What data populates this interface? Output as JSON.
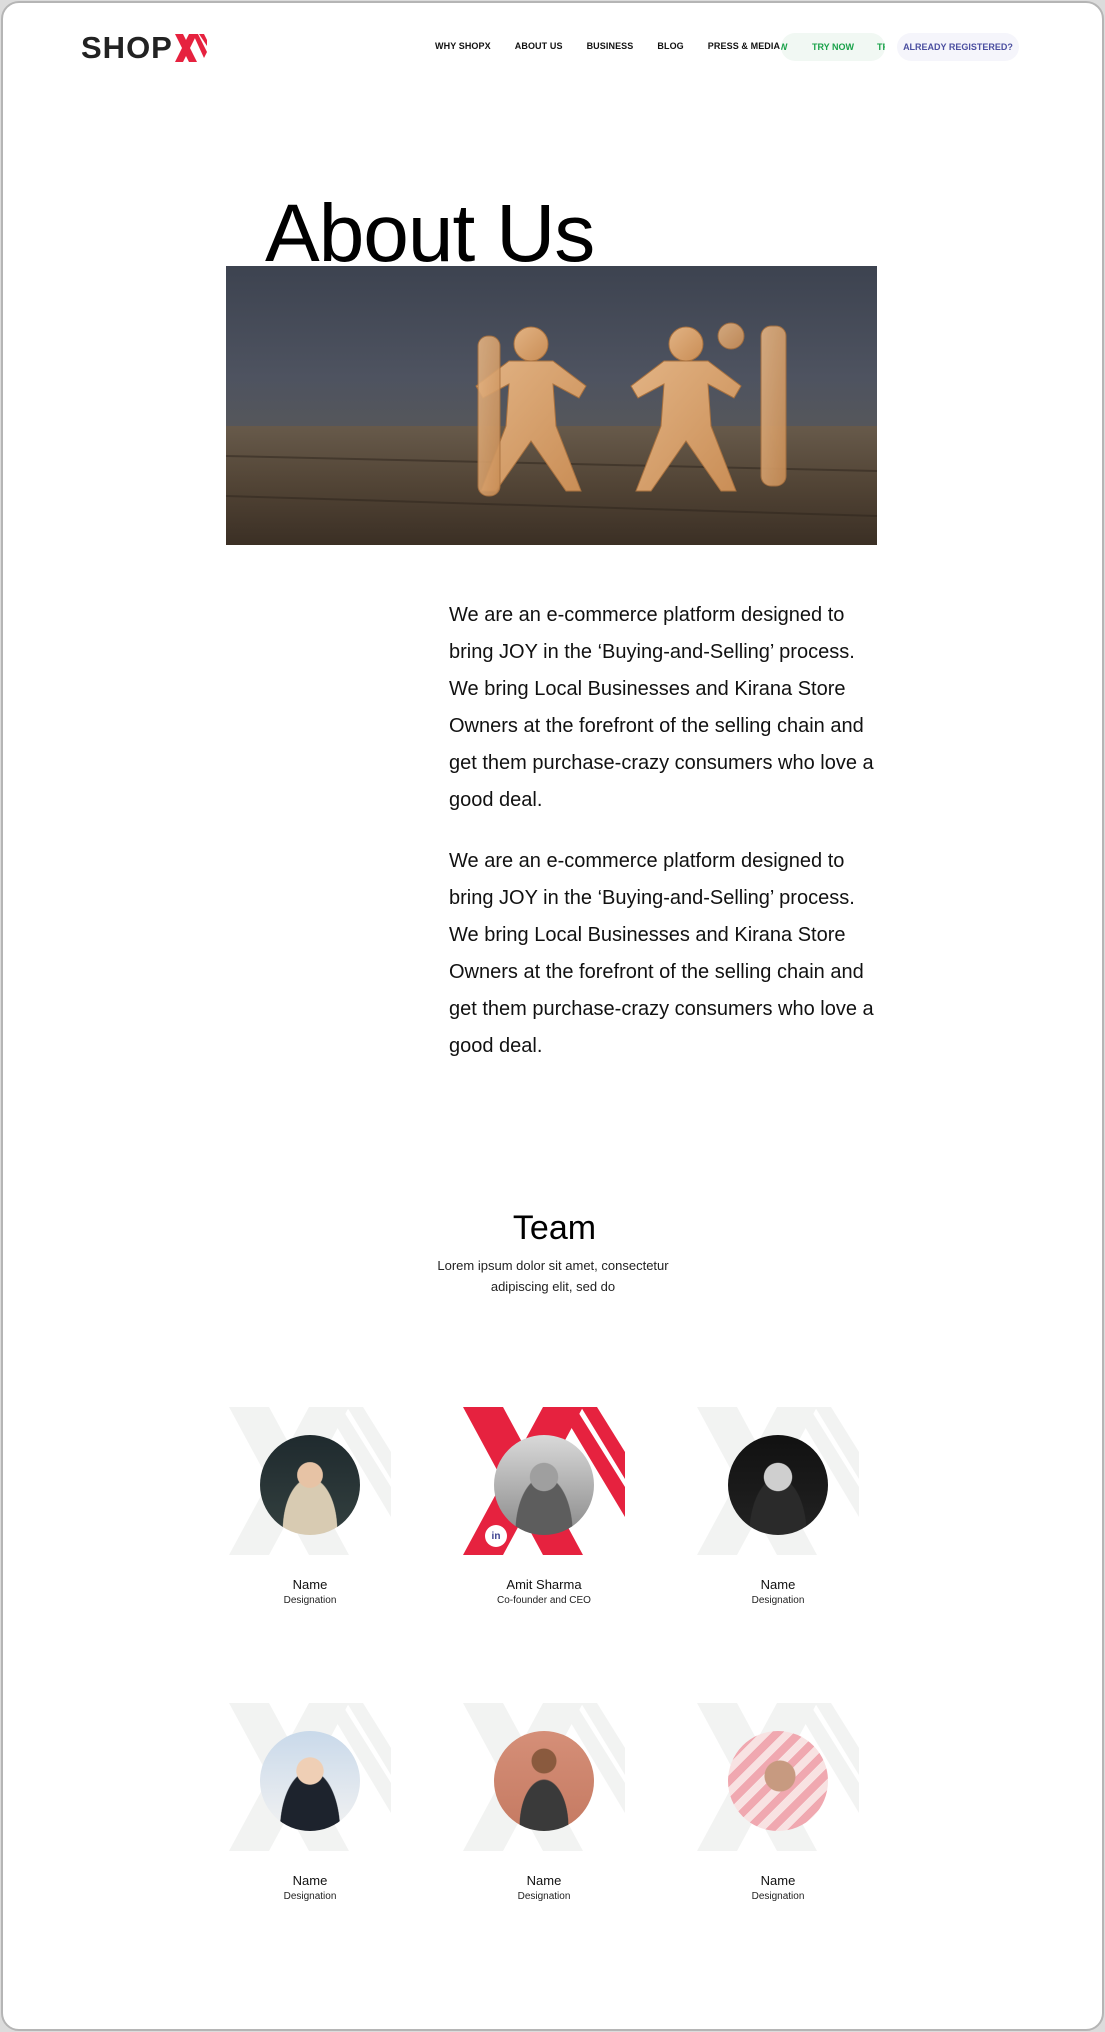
{
  "header": {
    "logo_text": "SHOP",
    "logo_accent": "#e6223f",
    "nav": [
      "WHY SHOPX",
      "ABOUT US",
      "BUSINESS",
      "BLOG",
      "PRESS & MEDIA"
    ],
    "try_now": "TRY NOW",
    "try_ghost_left": "W",
    "try_ghost_right": "TR",
    "already_registered": "ALREADY REGISTERED?"
  },
  "hero": {
    "title": "About Us"
  },
  "about": {
    "paragraphs": [
      "We are an e-commerce platform designed to bring JOY in the ‘Buying-and-Selling’ process. We bring Local Businesses and Kirana Store Owners at the forefront of the selling chain and get them purchase-crazy consumers who love a good deal.",
      "We are an e-commerce platform designed to bring JOY in the ‘Buying-and-Selling’ process. We bring Local Businesses and Kirana Store Owners at the forefront of the selling chain and get them purchase-crazy consumers who love a good deal."
    ]
  },
  "team": {
    "title": "Team",
    "subtitle": "Lorem ipsum dolor sit amet, consectetur adipiscing elit, sed do",
    "members": [
      {
        "name": "Name",
        "designation": "Designation",
        "highlight": false
      },
      {
        "name": "Amit Sharma",
        "designation": "Co-founder and CEO",
        "highlight": true,
        "linkedin": "in"
      },
      {
        "name": "Name",
        "designation": "Designation",
        "highlight": false
      },
      {
        "name": "Name",
        "designation": "Designation",
        "highlight": false
      },
      {
        "name": "Name",
        "designation": "Designation",
        "highlight": false
      },
      {
        "name": "Name",
        "designation": "Designation",
        "highlight": false
      }
    ]
  },
  "colors": {
    "brand_red": "#e6223f",
    "try_green": "#1aa24a",
    "registered_blue": "#4b4fa0"
  }
}
